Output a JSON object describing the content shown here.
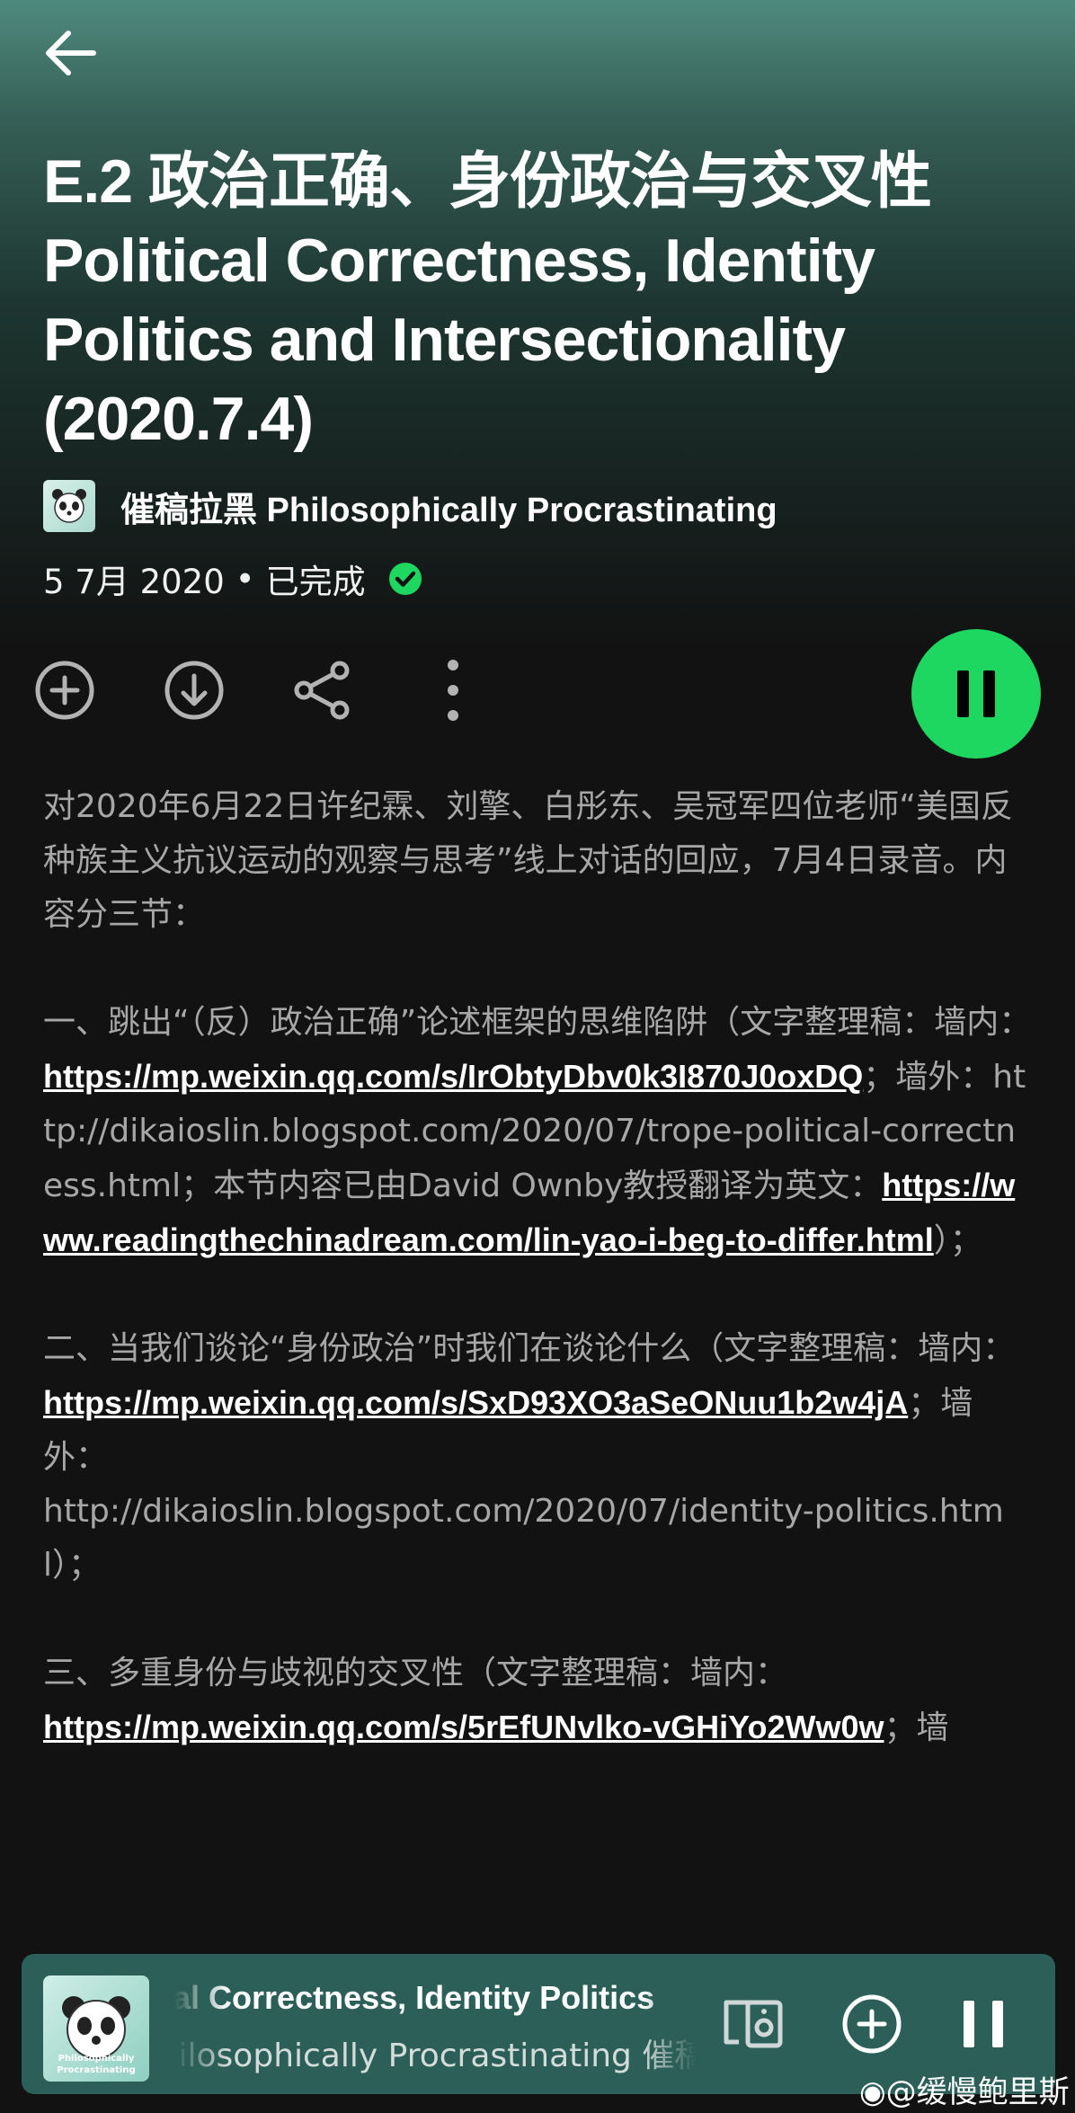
{
  "header": {
    "back_icon": "arrow-left-icon"
  },
  "episode": {
    "title": "E.2 政治正确、身份政治与交叉性 Political Correctness, Identity Politics and Intersectionality (2020.7.4)",
    "show_name": "催稿拉黑 Philosophically Procrastinating",
    "date": "5 7月 2020",
    "separator": "•",
    "status": "已完成"
  },
  "actions": {
    "add_icon": "plus-circle-icon",
    "download_icon": "download-circle-icon",
    "share_icon": "share-icon",
    "more_icon": "more-vertical-icon",
    "pause_icon": "pause-icon"
  },
  "description": {
    "intro": "对2020年6月22日许纪霖、刘擎、白彤东、吴冠军四位老师“美国反种族主义抗议运动的观察与思考”线上对话的回应，7月4日录音。内容分三节：",
    "s1_a": "一、跳出“（反）政治正确”论述框架的思维陷阱（文字整理稿：墙内：",
    "s1_link1": "https://mp.weixin.qq.com/s/IrObtyDbv0k3I870J0oxDQ",
    "s1_b": "；墙外：",
    "s1_url2": "http://dikaioslin.blogspot.com/2020/07/trope-political-correctness.html",
    "s1_c": "；本节内容已由David Ownby教授翻译为英文：",
    "s1_link3": "https://www.readingthechinadream.com/lin-yao-i-beg-to-differ.html",
    "s1_d": "）；",
    "s2_a": "二、当我们谈论“身份政治”时我们在谈论什么（文字整理稿：墙内：",
    "s2_link1": "https://mp.weixin.qq.com/s/SxD93XO3aSeONuu1b2w4jA",
    "s2_b": "；墙外：",
    "s2_url2": "http://dikaioslin.blogspot.com/2020/07/identity-politics.html",
    "s2_c": "）；",
    "s3_a": "三、多重身份与歧视的交叉性（文字整理稿：墙内：",
    "s3_link1": "https://mp.weixin.qq.com/s/5rEfUNvlko-vGHiYo2Ww0w",
    "s3_b": "；墙"
  },
  "mini_player": {
    "title": "Political Correctness, Identity Politics",
    "subtitle": "Philosophically Procrastinating   催稿拉黑 Philosophically",
    "art_text": "Philosophically Procrastinating",
    "device_icon": "connect-device-icon",
    "add_icon": "plus-circle-icon",
    "pause_icon": "pause-icon"
  },
  "watermark": "@缓慢鲍里斯",
  "colors": {
    "accent": "#1ed760",
    "background": "#121212",
    "mini_player": "#2c5f58"
  }
}
